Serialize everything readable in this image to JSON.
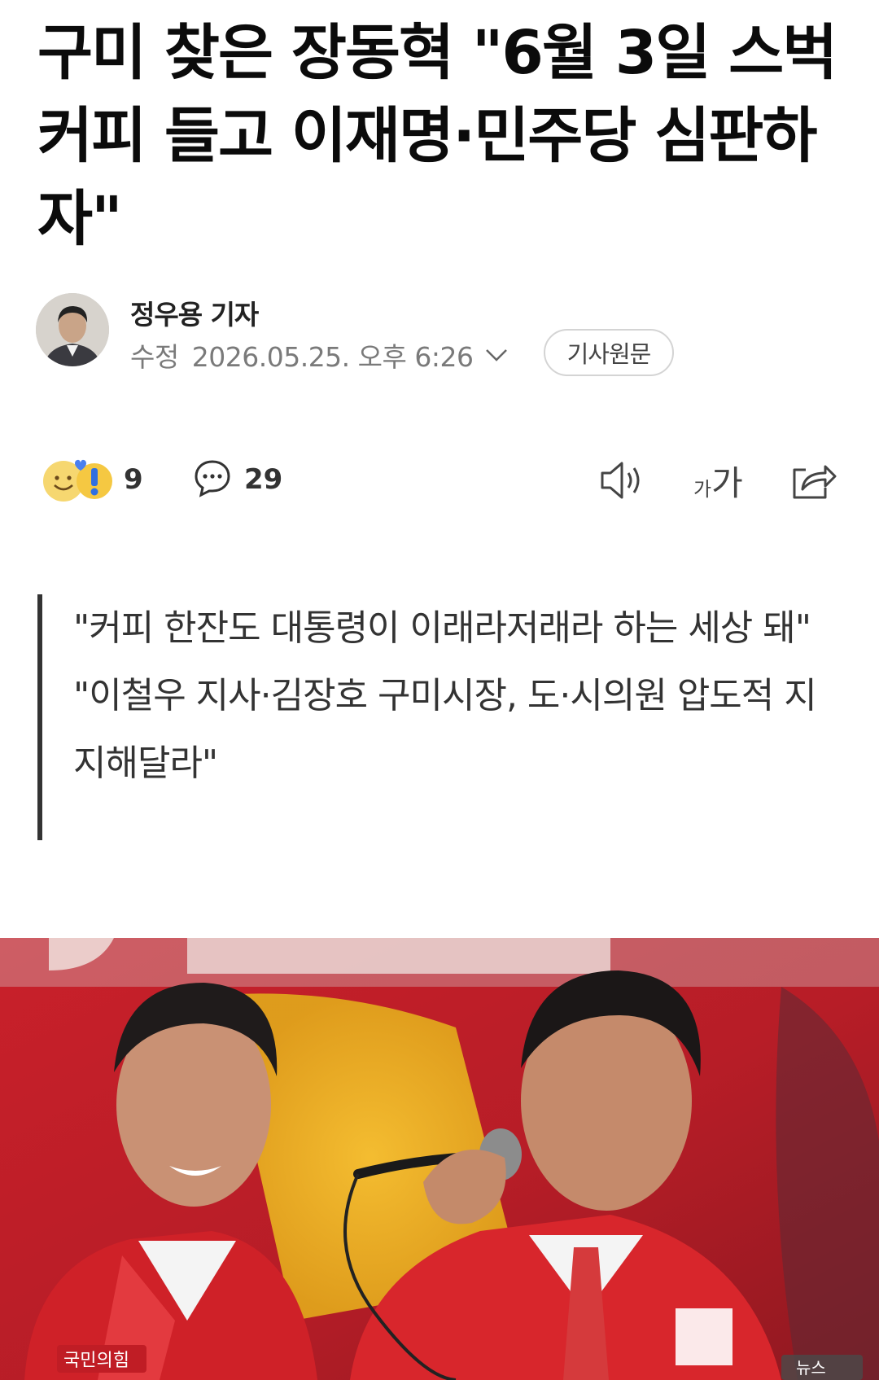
{
  "article": {
    "headline": "구미 찾은 장동혁 \"6월 3일 스벅커피 들고 이재명·민주당 심판하자\"",
    "reporter": "정우용 기자",
    "edit_label": "수정",
    "timestamp": "2026.05.25. 오후 6:26",
    "original_button": "기사원문"
  },
  "actions": {
    "reaction_count": "9",
    "comment_count": "29"
  },
  "summary": {
    "lines": [
      "\"커피 한잔도 대통령이 이래라저래라 하는 세상 돼\"",
      "\"이철우 지사·김장호 구미시장, 도·시의원 압도적 지지해달라\""
    ]
  },
  "photo": {
    "banner_text": "국민의힘",
    "corner_text": "뉴스"
  },
  "colors": {
    "rule": "#333333",
    "banner_red": "#d2202a",
    "jacket_red": "#d8262c"
  },
  "icons": [
    "reaction-emoji-icon",
    "comment-icon",
    "speaker-icon",
    "font-size-icon",
    "share-icon",
    "chevron-down-icon"
  ]
}
